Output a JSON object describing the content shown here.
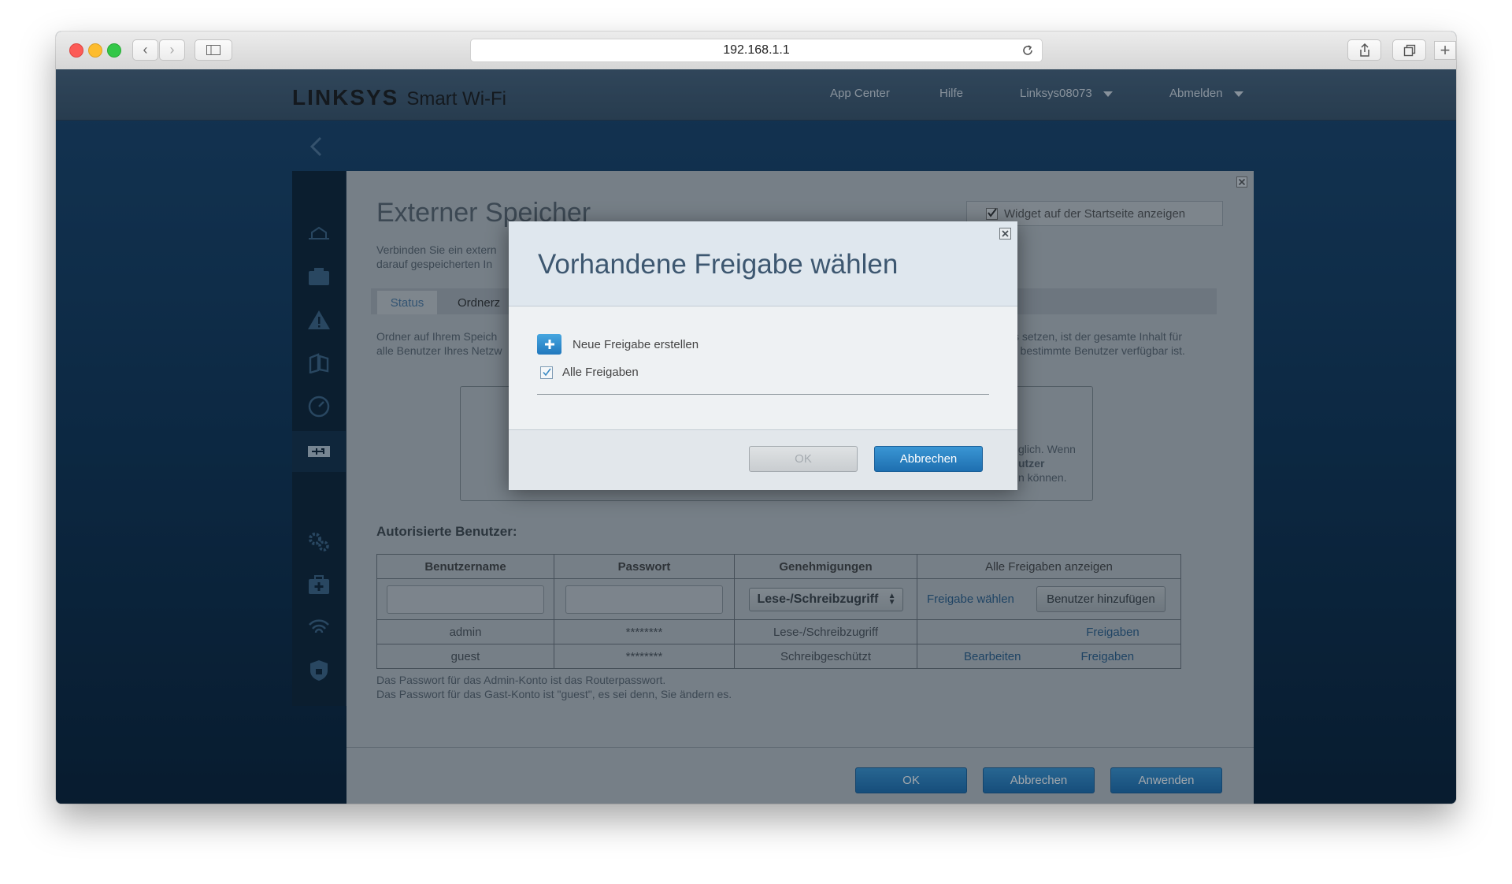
{
  "browser": {
    "url": "192.168.1.1"
  },
  "header": {
    "logo_brand": "LINKSYS",
    "logo_product": "Smart Wi-Fi",
    "nav": {
      "app_center": "App Center",
      "help": "Hilfe",
      "account": "Linksys08073",
      "logout": "Abmelden"
    }
  },
  "sidebar": {
    "icons": [
      "devices-icon",
      "media-icon",
      "alert-icon",
      "parental-icon",
      "speed-icon",
      "usb-icon",
      "settings-icon",
      "troubleshoot-icon",
      "wifi-icon",
      "security-icon"
    ]
  },
  "panel": {
    "title": "Externer Speicher",
    "widget_label": "Widget auf der Startseite anzeigen",
    "description_1": "Verbinden Sie ein extern",
    "description_2": "darauf gespeicherten In",
    "tabs": [
      "Status",
      "Ordnerz"
    ],
    "info_left_1": "Ordner auf Ihrem Speich",
    "info_left_2": "alle Benutzer Ihres Netzw",
    "info_right_1": "s setzen, ist der gesamte Inhalt für",
    "info_right_2": "r bestimmte Benutzer verfügbar ist.",
    "box_text_1": "glich. Wenn",
    "box_text_2": "utzer",
    "box_text_3": "n können.",
    "authorized_users_label": "Autorisierte Benutzer:",
    "table": {
      "headers": [
        "Benutzername",
        "Passwort",
        "Genehmigungen",
        "Alle Freigaben anzeigen"
      ],
      "permission_select": "Lese-/Schreibzugriff",
      "choose_share": "Freigabe wählen",
      "add_user": "Benutzer hinzufügen",
      "rows": [
        {
          "user": "admin",
          "password": "********",
          "permission": "Lese-/Schreibzugriff",
          "edit": "",
          "shares": "Freigaben"
        },
        {
          "user": "guest",
          "password": "********",
          "permission": "Schreibgeschützt",
          "edit": "Bearbeiten",
          "shares": "Freigaben"
        }
      ]
    },
    "note_1": "Das Passwort für das Admin-Konto ist das Routerpasswort.",
    "note_2": "Das Passwort für das Gast-Konto ist \"guest\", es sei denn, Sie ändern es.",
    "buttons": {
      "ok": "OK",
      "cancel": "Abbrechen",
      "apply": "Anwenden"
    }
  },
  "dialog": {
    "title": "Vorhandene Freigabe wählen",
    "new_share": "Neue Freigabe erstellen",
    "all_shares": "Alle Freigaben",
    "all_shares_checked": true,
    "ok": "OK",
    "cancel": "Abbrechen"
  }
}
